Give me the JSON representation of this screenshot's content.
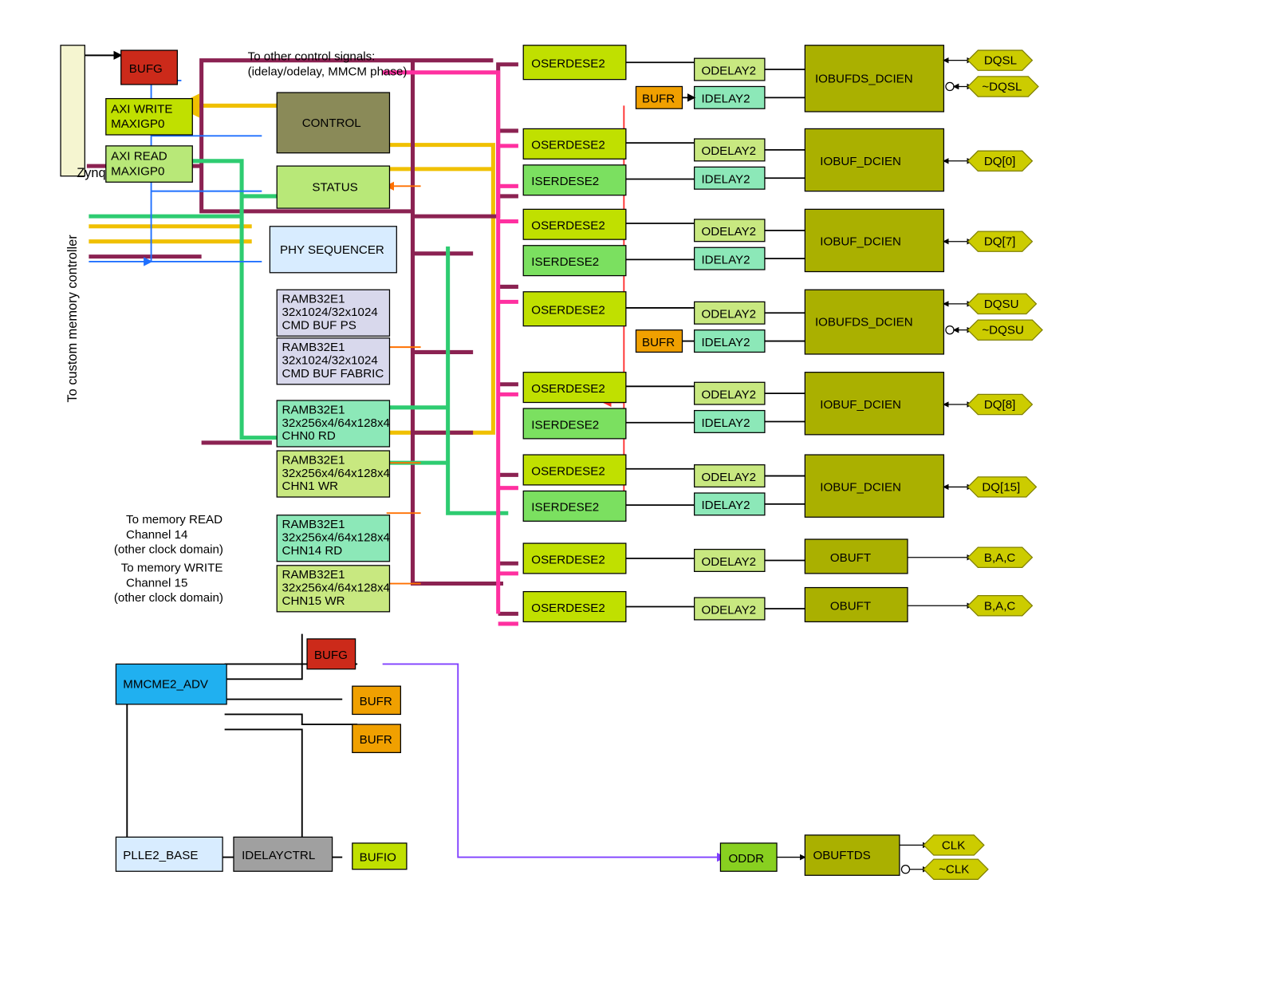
{
  "bridge_label": "Zynq PS-PL Bridge",
  "memctrl_label": "To custom memory controller",
  "note_signals1": "To other control signals:",
  "note_signals2": "(idelay/odelay, MMCM phase)",
  "note_read1": "To memory READ",
  "note_read2": "Channel 14",
  "note_read3": "(other clock domain)",
  "note_write1": "To memory WRITE",
  "note_write2": "Channel 15",
  "note_write3": "(other clock domain)",
  "blocks": {
    "bufg1": "BUFG",
    "axi_write1": "AXI WRITE",
    "axi_write2": "MAXIGP0",
    "axi_read1": "AXI READ",
    "axi_read2": "MAXIGP0",
    "control": "CONTROL",
    "status": "STATUS",
    "physeq": "PHY SEQUENCER",
    "ramb_ps1": "RAMB32E1",
    "ramb_ps2": "32x1024/32x1024",
    "ramb_ps3": "CMD BUF PS",
    "ramb_fab1": "RAMB32E1",
    "ramb_fab2": "32x1024/32x1024",
    "ramb_fab3": "CMD BUF FABRIC",
    "chn0_1": "RAMB32E1",
    "chn0_2": "32x256x4/64x128x4",
    "chn0_3": "CHN0  RD",
    "chn1_1": "RAMB32E1",
    "chn1_2": "32x256x4/64x128x4",
    "chn1_3": "CHN1 WR",
    "chn14_1": "RAMB32E1",
    "chn14_2": "32x256x4/64x128x4",
    "chn14_3": "CHN14  RD",
    "chn15_1": "RAMB32E1",
    "chn15_2": "32x256x4/64x128x4",
    "chn15_3": "CHN15 WR",
    "mmcm": "MMCME2_ADV",
    "plle2": "PLLE2_BASE",
    "idelayctrl": "IDELAYCTRL",
    "bufg2": "BUFG",
    "bufr1": "BUFR",
    "bufr2": "BUFR",
    "bufio": "BUFIO",
    "oddr": "ODDR",
    "obuftds": "OBUFTDS"
  },
  "column": {
    "oserdese2": "OSERDESE2",
    "iserdese2": "ISERDESE2",
    "odelay2": "ODELAY2",
    "idelay2": "IDELAY2",
    "bufr": "BUFR",
    "iobufds_dcien": "IOBUFDS_DCIEN",
    "iobuf_dcien": "IOBUF_DCIEN",
    "obuft": "OBUFT"
  },
  "ports": {
    "dqsl": "DQSL",
    "ndqsl": "~DQSL",
    "dq0": "DQ[0]",
    "dq7": "DQ[7]",
    "dqsu": "DQSU",
    "ndqsu": "~DQSU",
    "dq8": "DQ[8]",
    "dq15": "DQ[15]",
    "bac1": "B,A,C",
    "bac2": "B,A,C",
    "clk": "CLK",
    "nclk": "~CLK"
  },
  "colors": {
    "olive": "#aab000",
    "olive_dk": "#808000",
    "yellowgreen": "#c0e000",
    "lime": "#7be060",
    "mint": "#8ce8b8",
    "orange": "#f0a000",
    "red": "#cc2a1a",
    "cyan": "#20b0f0",
    "lavender": "#d8d8ec",
    "gray": "#a0a0a0",
    "beige": "#f5f5d0",
    "khaki": "#8a8a58",
    "greenlt": "#b8e878"
  },
  "wires": {
    "maroon": "#8b2252",
    "yellow": "#f0c000",
    "green": "#2ecc71",
    "blue": "#2070ff",
    "orange_w": "#ff7000",
    "magenta": "#ff30a0",
    "purple": "#8040ff",
    "black": "#000000",
    "red_w": "#ff3030"
  }
}
